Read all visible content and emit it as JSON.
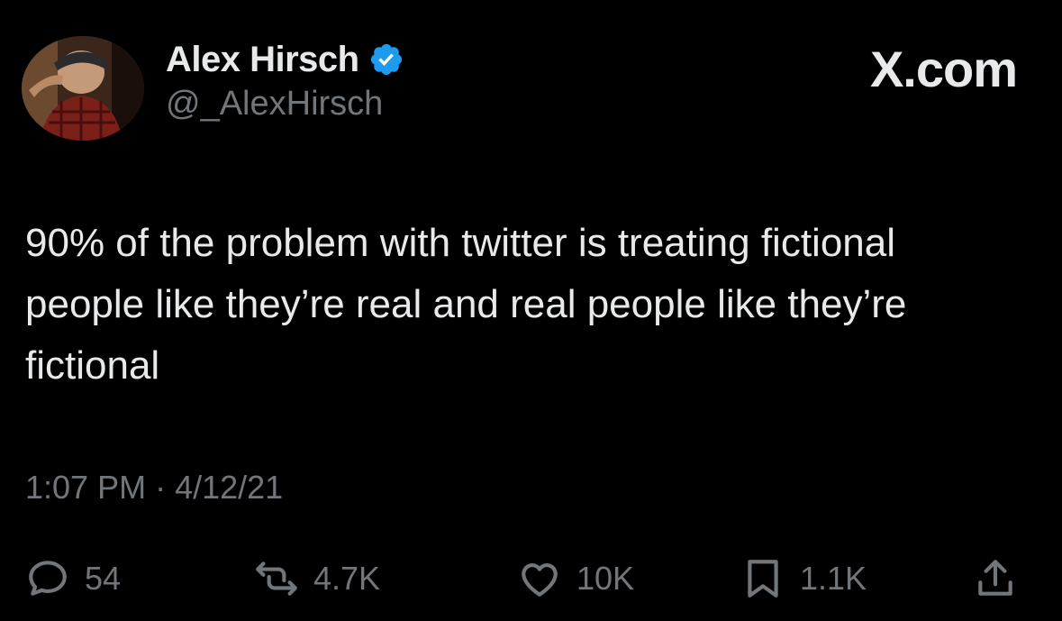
{
  "author": {
    "name": "Alex Hirsch",
    "handle": "@_AlexHirsch",
    "verified": true
  },
  "source": "X.com",
  "tweet": {
    "text": "90% of the problem with twitter is treating fictional people like they’re real and real people like they’re fictional",
    "time": "1:07 PM",
    "separator": "·",
    "date": "4/12/21"
  },
  "actions": {
    "replies": "54",
    "reposts": "4.7K",
    "likes": "10K",
    "bookmarks": "1.1K"
  },
  "colors": {
    "background": "#000000",
    "text": "#e7e9ea",
    "secondary": "#71767b",
    "verified": "#1d9bf0"
  }
}
